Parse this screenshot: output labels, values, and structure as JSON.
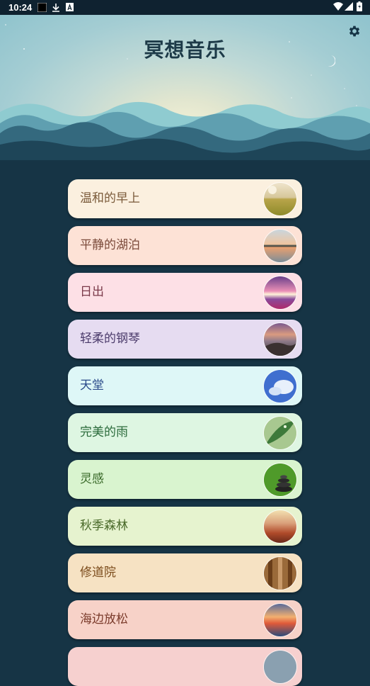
{
  "status_bar": {
    "time": "10:24"
  },
  "header": {
    "title": "冥想音乐"
  },
  "tracks": [
    {
      "label": "温和的早上",
      "bg": "#fbf0df",
      "fg": "#7a5a3a",
      "thumb": "morning-meadow-thumbnail"
    },
    {
      "label": "平静的湖泊",
      "bg": "#fde2d6",
      "fg": "#7a4a3a",
      "thumb": "sunset-lake-thumbnail"
    },
    {
      "label": "日出",
      "bg": "#fde0e6",
      "fg": "#7a3a4a",
      "thumb": "sunrise-thumbnail"
    },
    {
      "label": "轻柔的钢琴",
      "bg": "#e6dcf1",
      "fg": "#4a3a6a",
      "thumb": "misty-mountains-thumbnail"
    },
    {
      "label": "天堂",
      "bg": "#def7f7",
      "fg": "#2a4a8a",
      "thumb": "blue-sky-clouds-thumbnail"
    },
    {
      "label": "完美的雨",
      "bg": "#def6e2",
      "fg": "#2a6a3a",
      "thumb": "rain-leaf-thumbnail"
    },
    {
      "label": "灵感",
      "bg": "#d9f4cf",
      "fg": "#3a6a2a",
      "thumb": "zen-stones-thumbnail"
    },
    {
      "label": "秋季森林",
      "bg": "#e6f3cf",
      "fg": "#4a6a2a",
      "thumb": "autumn-forest-thumbnail"
    },
    {
      "label": "修道院",
      "bg": "#f6e2c3",
      "fg": "#7a4a1a",
      "thumb": "monastery-hall-thumbnail"
    },
    {
      "label": "海边放松",
      "bg": "#f7d2c8",
      "fg": "#7a3a2a",
      "thumb": "seaside-sunset-thumbnail"
    },
    {
      "label": "",
      "bg": "#f6d0cf",
      "fg": "#7a3a3a",
      "thumb": "partial-thumbnail"
    }
  ]
}
